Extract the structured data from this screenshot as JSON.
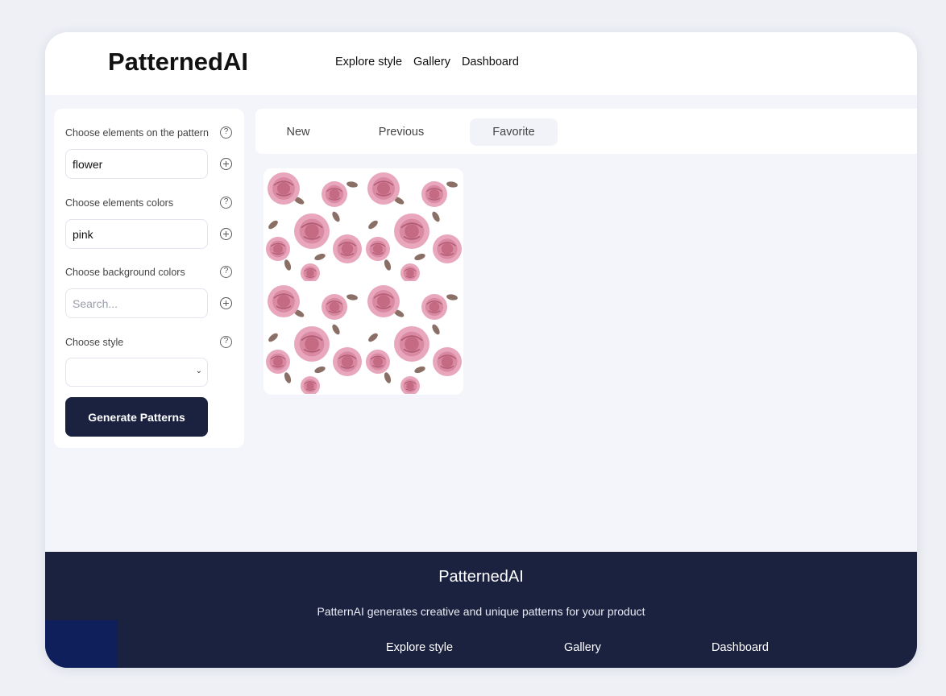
{
  "app": {
    "logo": "PatternedAI"
  },
  "nav": [
    "Explore style",
    "Gallery",
    "Dashboard"
  ],
  "sidebar": {
    "elements": {
      "label": "Choose elements on the pattern",
      "value": "flower"
    },
    "element_colors": {
      "label": "Choose elements colors",
      "value": "pink"
    },
    "background_colors": {
      "label": "Choose background colors",
      "placeholder": "Search..."
    },
    "style": {
      "label": "Choose style",
      "value": ""
    },
    "generate_label": "Generate Patterns",
    "help_glyph": "?"
  },
  "tabs": {
    "new": "New",
    "previous": "Previous",
    "favorite": "Favorite",
    "active": "Favorite"
  },
  "gallery": {
    "items": [
      {
        "icon": "rose-pattern-thumbnail",
        "colors": [
          "#e8a7bc",
          "#c56a83",
          "#8a6f66",
          "#ffffff"
        ]
      }
    ]
  },
  "footer": {
    "title": "PatternedAI",
    "description": "PatternAI generates creative and unique patterns for your product",
    "links": [
      "Explore style",
      "Gallery",
      "Dashboard"
    ]
  },
  "colors": {
    "accent": "#1b2240",
    "background": "#f4f5fa"
  }
}
